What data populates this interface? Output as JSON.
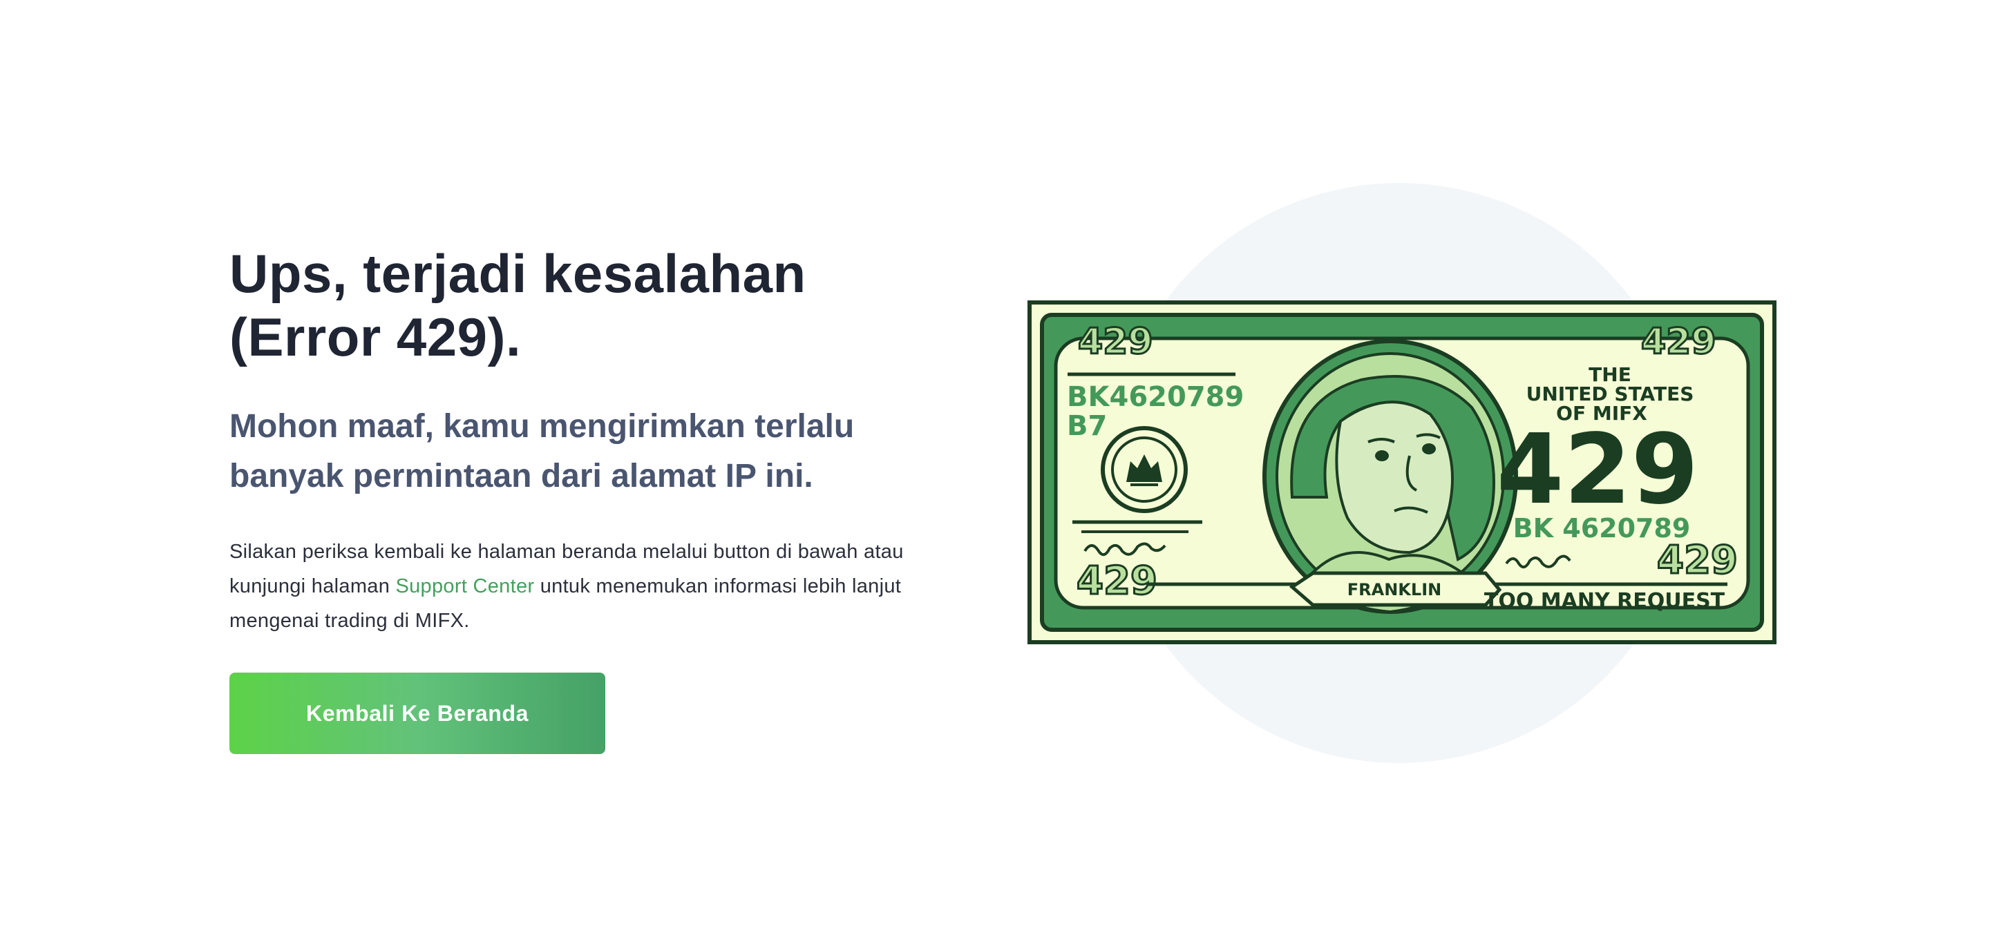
{
  "heading": {
    "line1": "Ups, terjadi kesalahan",
    "line2": "(Error 429)."
  },
  "subheading": {
    "line1": "Mohon maaf, kamu mengirimkan terlalu",
    "line2": "banyak permintaan dari alamat IP ini."
  },
  "description": {
    "before_link": "Silakan periksa kembali ke halaman beranda melalui button di bawah atau kunjungi halaman ",
    "link_label": "Support Center",
    "after_link": " untuk menemukan informasi lebih lanjut mengenai trading di MIFX."
  },
  "button": {
    "label": "Kembali Ke Beranda"
  },
  "banknote": {
    "corner_number": "429",
    "serial": "BK4620789",
    "serial_suffix": "B7",
    "serial_right": "BK 4620789",
    "issuer_line1": "THE",
    "issuer_line2": "UNITED  STATES",
    "issuer_line3": "OF  MIFX",
    "big_number": "429",
    "portrait_name": "FRANKLIN",
    "caption": "TOO MANY REQUEST"
  },
  "colors": {
    "title": "#1f2533",
    "subtitle": "#4a5570",
    "link": "#43a05c",
    "note_dark": "#1b3d22",
    "note_green": "#44995a",
    "note_light": "#f5fcd6",
    "circle_bg": "#f2f6f9"
  }
}
